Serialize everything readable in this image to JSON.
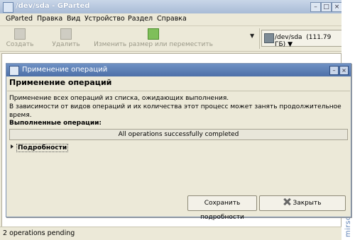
{
  "window": {
    "title": "/dev/sda - GParted",
    "minimize": "–",
    "maximize": "□",
    "close": "×"
  },
  "menu": [
    "GParted",
    "Правка",
    "Вид",
    "Устройство",
    "Раздел",
    "Справка"
  ],
  "toolbar": {
    "create": "Создать",
    "delete": "Удалить",
    "resize": "Изменить размер или переместить",
    "arrow": "▼"
  },
  "device": {
    "name": "/dev/sda",
    "size": "(111.79 ГБ)",
    "arrow": "▼"
  },
  "statusbar": "2 operations pending",
  "watermark": "mirsovetov2.ru",
  "dialog": {
    "title": "Применение операций",
    "heading": "Применение операций",
    "description_line1": "Применение всех операций из списка, ожидающих выполнения.",
    "description_line2": "В зависимости от видов операций и их количества этот процесс может занять продолжительное время.",
    "completed_label": "Выполненные операции:",
    "progress": {
      "text": "All operations successfully completed",
      "fraction": 1.0
    },
    "details_label": "Подробности",
    "save_button": "Сохранить подробности",
    "close_button": "Закрыть",
    "ctrl_minimize": "–",
    "ctrl_close": "×"
  }
}
